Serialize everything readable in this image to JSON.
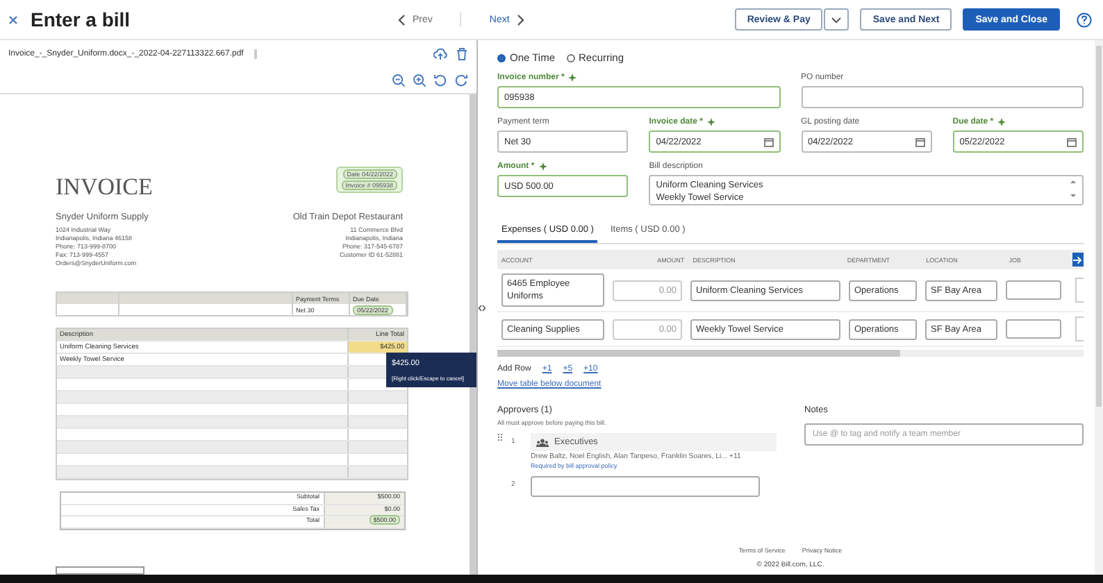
{
  "header": {
    "title": "Enter a bill",
    "prev": "Prev",
    "next": "Next",
    "buttons": [
      {
        "label": "Review & Pay",
        "kind": "outline"
      },
      {
        "label": "Save and Next",
        "kind": "outline"
      },
      {
        "label": "Save and Close",
        "kind": "primary"
      }
    ]
  },
  "document": {
    "filename": "Invoice_-_Snyder_Uniform.docx_-_2022-04-227113322.667.pdf",
    "invoice": {
      "heading": "INVOICE",
      "meta": [
        {
          "label": "Date",
          "value": "04/22/2022",
          "highlighted": true
        },
        {
          "label": "Invoice #",
          "value": "095938",
          "highlighted": true
        }
      ],
      "supplier": {
        "name": "Snyder Uniform Supply",
        "lines": [
          "1024 Industrial Way",
          "Indianapolis, Indiana 46158",
          "Phone: 713-999-8700",
          "Fax: 713-999-4557",
          "Orders@SnyderUniform.com"
        ]
      },
      "customer": {
        "name": "Old Train Depot Restaurant",
        "lines": [
          "11 Commerce Blvd",
          "Indianapolis, Indiana",
          "Phone: 317-545-6787",
          "Customer ID 61-52881"
        ]
      },
      "terms": [
        {
          "header": "Payment Terms",
          "value": "Net 30",
          "highlighted": false
        },
        {
          "header": "Due Date",
          "value": "05/22/2022",
          "highlighted": true
        }
      ],
      "items": {
        "columns": [
          "Description",
          "Line Total"
        ],
        "rows": [
          {
            "description": "Uniform Cleaning Services",
            "total": "$425.00",
            "highlighted": true
          },
          {
            "description": "Weekly Towel Service",
            "total": "",
            "highlighted": false
          }
        ]
      },
      "tooltip": {
        "value": "$425.00",
        "hint": "[Right click/Escape to cancel]"
      },
      "totals": [
        {
          "label": "Subtotal",
          "value": "$500.00",
          "highlighted": false
        },
        {
          "label": "Sales Tax",
          "value": "$0.00",
          "highlighted": false
        },
        {
          "label": "Total",
          "value": "$500.00",
          "highlighted": true
        }
      ]
    }
  },
  "form": {
    "frequency": [
      {
        "label": "One Time",
        "selected": true
      },
      {
        "label": "Recurring",
        "selected": false
      }
    ],
    "rows": [
      {
        "fields": [
          {
            "label": "Invoice number *",
            "autofilled": true,
            "kind": "text",
            "value": "095938"
          },
          {
            "label": "PO number",
            "autofilled": false,
            "kind": "text"
          }
        ]
      },
      {
        "fields": [
          {
            "label": "Payment term",
            "autofilled": false,
            "kind": "text",
            "value": "Net 30"
          },
          {
            "label": "Invoice date *",
            "autofilled": true,
            "kind": "date",
            "value": "04/22/2022"
          },
          {
            "label": "GL posting date",
            "autofilled": false,
            "kind": "date",
            "value": "04/22/2022"
          },
          {
            "label": "Due date *",
            "autofilled": true,
            "kind": "date",
            "value": "05/22/2022"
          }
        ]
      },
      {
        "fields": [
          {
            "label": "Amount *",
            "autofilled": true,
            "kind": "text",
            "value": "USD 500.00"
          },
          {
            "label": "Bill description",
            "autofilled": false,
            "kind": "textarea",
            "value": "Uniform Cleaning Services\nWeekly Towel Service"
          }
        ]
      }
    ]
  },
  "tabs": [
    {
      "label": "Expenses ( USD 0.00 )",
      "selected": true
    },
    {
      "label": "Items ( USD 0.00 )",
      "selected": false
    }
  ],
  "table": {
    "columns": [
      "ACCOUNT",
      "AMOUNT",
      "DESCRIPTION",
      "DEPARTMENT",
      "LOCATION",
      "JOB"
    ],
    "rows": [
      [
        "6465 Employee Uniforms",
        "0.00",
        "Uniform Cleaning Services",
        "Operations",
        "SF Bay Area",
        ""
      ],
      [
        "Cleaning Supplies",
        "0.00",
        "Weekly Towel Service",
        "Operations",
        "SF Bay Area",
        ""
      ]
    ]
  },
  "add_row": {
    "label": "Add Row",
    "options": [
      "+1",
      "+5",
      "+10"
    ]
  },
  "move_link": "Move table below document",
  "approvers": {
    "title": "Approvers (1)",
    "note": "All must approve before paying this bill.",
    "steps": [
      {
        "number": "1",
        "group": "Executives",
        "members": "Drew Baltz, Noel English, Alan Tanpeso, Franklin Soares, Li... +11",
        "policy": "Required by bill approval policy"
      },
      {
        "number": "2"
      }
    ]
  },
  "notes": {
    "title": "Notes",
    "placeholder": "Use @ to tag and notify a team member"
  },
  "footer": {
    "links": [
      "Terms of Service",
      "Privacy Notice"
    ],
    "copyright": "© 2022 Bill.com, LLC."
  }
}
